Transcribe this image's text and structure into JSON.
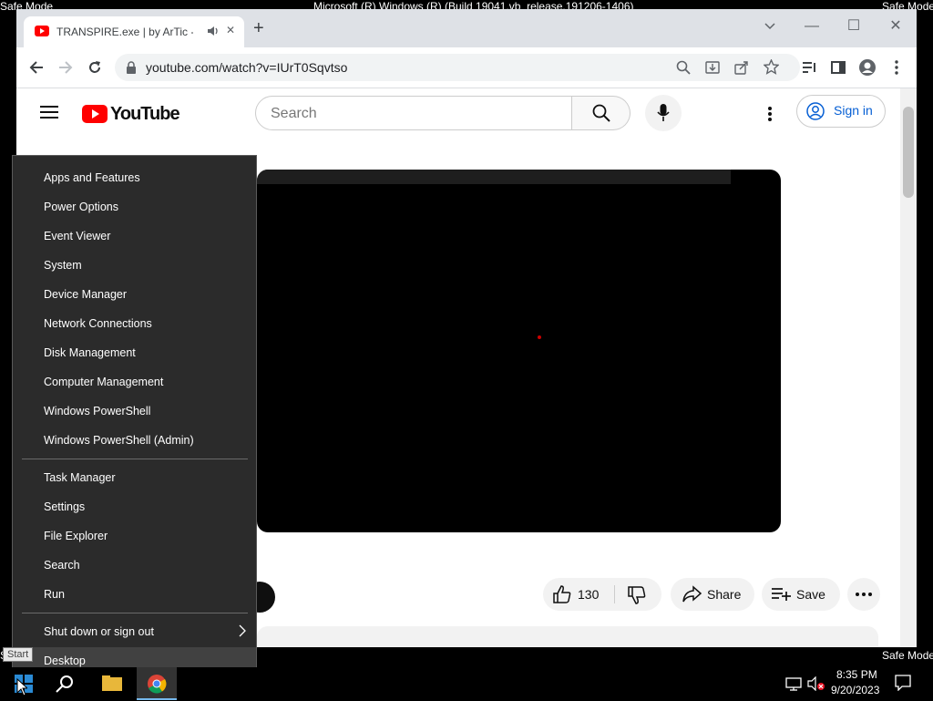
{
  "desktop": {
    "safe_mode_label": "Safe Mode",
    "build_text": "Microsoft (R) Windows (R) (Build 19041.vb_release.191206-1406)"
  },
  "browser": {
    "tab_title": "TRANSPIRE.exe | by ArTic - YouTube",
    "new_tab": "+",
    "url": "youtube.com/watch?v=IUrT0Sqvtso",
    "min_glyph": "—",
    "max_glyph": "☐",
    "close_glyph": "✕",
    "tab_close_glyph": "✕"
  },
  "youtube": {
    "logo_text": "YouTube",
    "search_placeholder": "Search",
    "sign_in": "Sign in",
    "like_count": "130",
    "share_label": "Share",
    "save_label": "Save",
    "colors": {
      "brand_red": "#ff0000",
      "signin_blue": "#065fd4"
    }
  },
  "context_menu": {
    "group1": [
      "Apps and Features",
      "Power Options",
      "Event Viewer",
      "System",
      "Device Manager",
      "Network Connections",
      "Disk Management",
      "Computer Management",
      "Windows PowerShell",
      "Windows PowerShell (Admin)"
    ],
    "group2": [
      "Task Manager",
      "Settings",
      "File Explorer",
      "Search",
      "Run"
    ],
    "group3": [
      "Shut down or sign out",
      "Desktop"
    ],
    "submenu_arrow": ">"
  },
  "taskbar": {
    "tooltip": "Start",
    "time": "8:35 PM",
    "date": "9/20/2023"
  }
}
